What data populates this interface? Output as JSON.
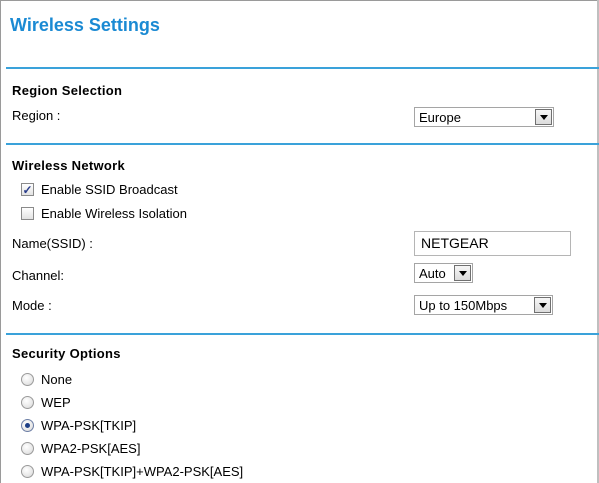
{
  "page": {
    "title": "Wireless Settings"
  },
  "region_section": {
    "heading": "Region Selection",
    "region_label": "Region :",
    "region_value": "Europe"
  },
  "network_section": {
    "heading": "Wireless Network",
    "ssid_broadcast_label": "Enable SSID Broadcast",
    "ssid_broadcast_checked": true,
    "isolation_label": "Enable Wireless Isolation",
    "isolation_checked": false,
    "name_label": "Name(SSID) :",
    "name_value": "NETGEAR",
    "channel_label": "Channel:",
    "channel_value": "Auto",
    "mode_label": "Mode :",
    "mode_value": "Up to 150Mbps"
  },
  "security_section": {
    "heading": "Security Options",
    "options": [
      {
        "label": "None",
        "selected": false
      },
      {
        "label": "WEP",
        "selected": false
      },
      {
        "label": "WPA-PSK[TKIP]",
        "selected": true
      },
      {
        "label": "WPA2-PSK[AES]",
        "selected": false
      },
      {
        "label": "WPA-PSK[TKIP]+WPA2-PSK[AES]",
        "selected": false
      }
    ]
  },
  "colors": {
    "accent": "#1b8ad3",
    "rule": "#3aa2da",
    "radio_selected": "#1e3f86"
  }
}
